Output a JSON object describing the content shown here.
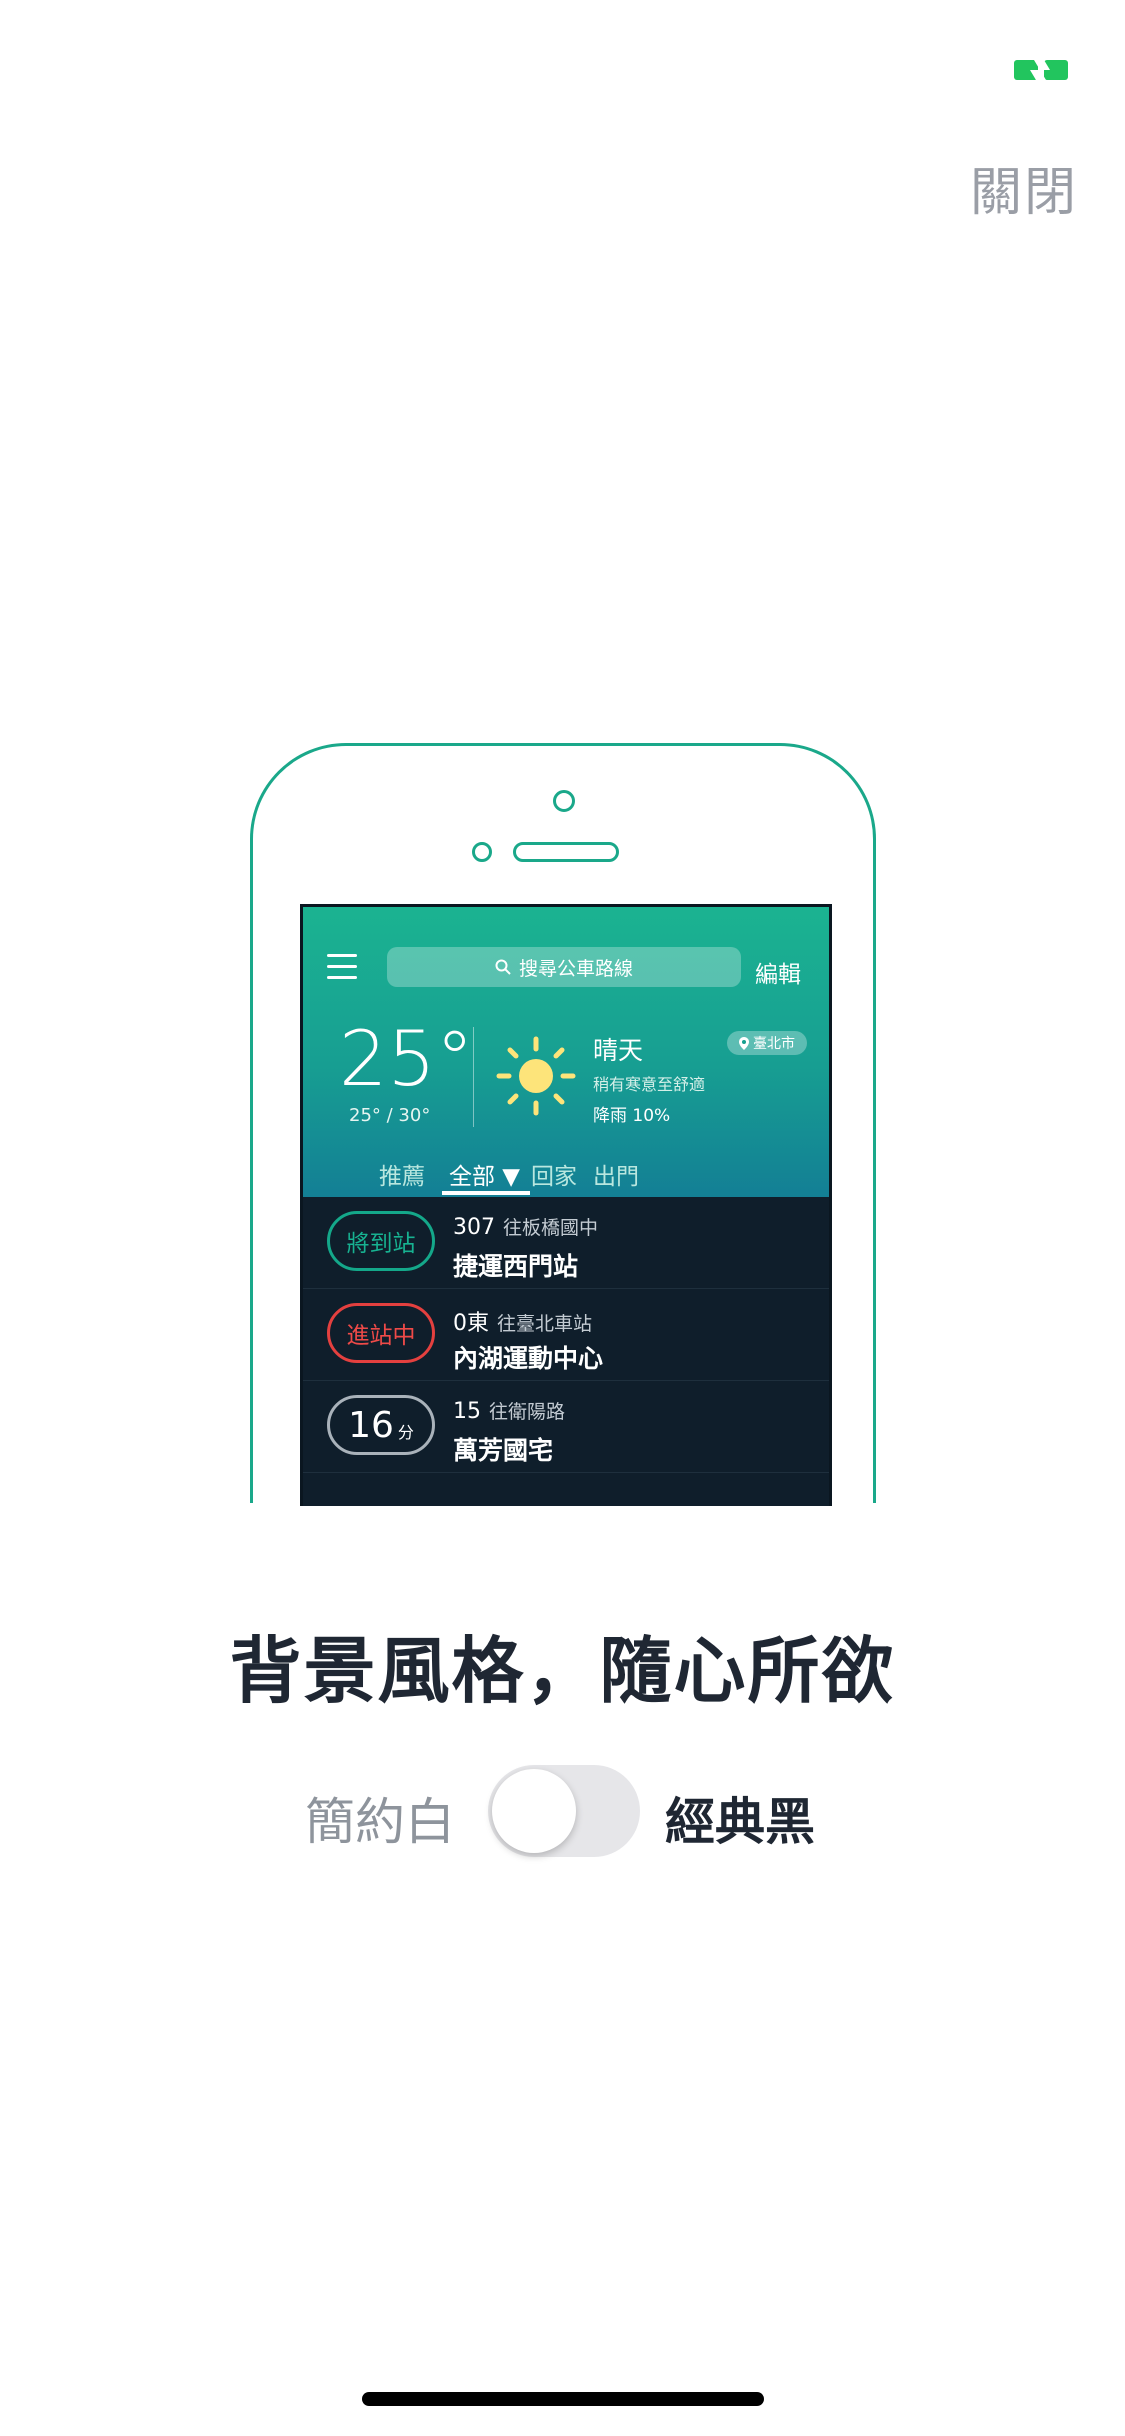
{
  "top": {
    "close_label": "關閉",
    "status_icon": "battery-charging-icon"
  },
  "phone_preview": {
    "search_placeholder": "搜尋公車路線",
    "edit_label": "編輯",
    "weather": {
      "temperature": "25°",
      "temp_range": "25° / 30°",
      "condition": "晴天",
      "description": "稍有寒意至舒適",
      "rain": "降雨 10%",
      "city": "臺北市",
      "icon": "sun-icon"
    },
    "tabs": [
      {
        "label": "推薦"
      },
      {
        "label": "全部 ▼"
      },
      {
        "label": "回家"
      },
      {
        "label": "出門"
      }
    ],
    "active_tab": "全部",
    "arrivals": [
      {
        "status": "將到站",
        "route": "307",
        "direction": "往板橋國中",
        "stop": "捷運西門站",
        "color": "#14a88a"
      },
      {
        "status": "進站中",
        "route": "0東",
        "direction": "往臺北車站",
        "stop": "內湖運動中心",
        "color": "#e4403f"
      },
      {
        "status_num": "16",
        "status_unit": "分",
        "route": "15",
        "direction": "往衛陽路",
        "stop": "萬芳國宅",
        "color": "#a9b2ba"
      }
    ]
  },
  "headline": "背景風格，隨心所欲",
  "theme_toggle": {
    "left_label": "簡約白",
    "right_label": "經典黑",
    "state": "off"
  },
  "colors": {
    "accent": "#1aa88a",
    "text": "#1f2733",
    "muted": "#8e949c"
  }
}
